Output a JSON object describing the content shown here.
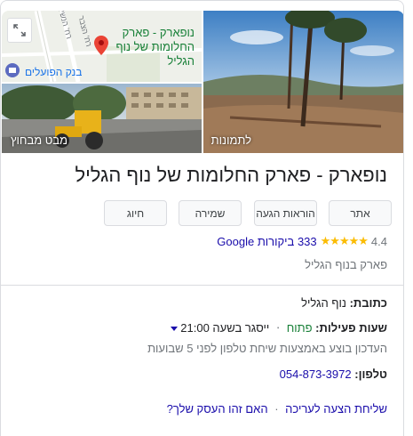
{
  "photos": {
    "main_label": "לתמונות",
    "street_label": "מבט מבחוץ"
  },
  "map": {
    "place_label": "נופארק - פארק החלומות של נוף הגליל",
    "bank_label": "בנק הפועלים",
    "road_1": "רח' הנשיא",
    "road_2": "רח' הצבר"
  },
  "title": "נופארק - פארק החלומות של נוף הגליל",
  "actions": [
    {
      "label": "אתר"
    },
    {
      "label": "הוראות הגעה"
    },
    {
      "label": "שמירה"
    },
    {
      "label": "חיוג"
    }
  ],
  "rating": {
    "value": "4.4",
    "stars": "★★★★★",
    "reviews": "333 ביקורות Google"
  },
  "category": "פארק בנוף הגליל",
  "address": {
    "label": "כתובת:",
    "value": "נוף הגליל"
  },
  "hours": {
    "label": "שעות פעילות:",
    "status": "פתוח",
    "separator": "⋅",
    "closes": "ייסגר בשעה 21:00",
    "update_note": "העדכון בוצע באמצעות שיחת טלפון לפני 5 שבועות"
  },
  "phone": {
    "label": "טלפון:",
    "value": "054-873-3972"
  },
  "footer": {
    "suggest_edit": "שליחת הצעה לעריכה",
    "separator": "·",
    "own_business": "האם זהו העסק שלך?"
  },
  "colors": {
    "link": "#1a0dab",
    "open": "#188038",
    "star": "#fbbc04",
    "map_pin": "#ea4335"
  }
}
